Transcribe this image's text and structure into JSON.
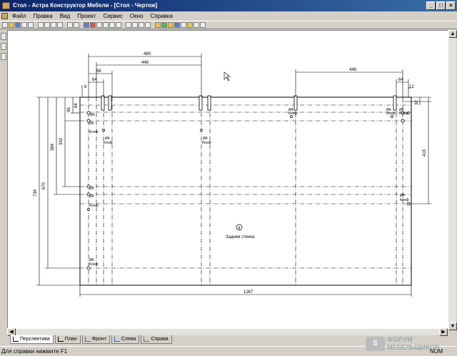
{
  "window": {
    "title": "Стол - Астра Конструктор Мебели - [Стол - Чертеж]"
  },
  "menu": [
    "Файл",
    "Правка",
    "Вид",
    "Проект",
    "Сервис",
    "Окно",
    "Справка"
  ],
  "drawing": {
    "panel_number": "4",
    "panel_name": "Задняя стенка",
    "dims_top": {
      "d480": "480",
      "d448a": "448",
      "d96": "96",
      "d64a": "64",
      "d448b": "448",
      "d64b": "64",
      "d8": "8",
      "d12": "12",
      "d32": "32"
    },
    "dims_left": {
      "d734": "734",
      "d670": "670",
      "d384": "384",
      "d332": "332",
      "d96": "96",
      "d64": "64"
    },
    "dim_right": "418",
    "dim_bottom": "1267",
    "hole_labels": {
      "d6": "Ø6",
      "d4": "Ø4",
      "kf": "Конф"
    }
  },
  "tabs": [
    "Перспектива",
    "План",
    "Фронт",
    "Слева",
    "Справа"
  ],
  "status": {
    "text": "Для справки нажмите F1",
    "num": "NUM"
  },
  "watermark": {
    "line1": "ФОРУМ",
    "line2": "МЕБЕЛЬЩИКОВ"
  }
}
